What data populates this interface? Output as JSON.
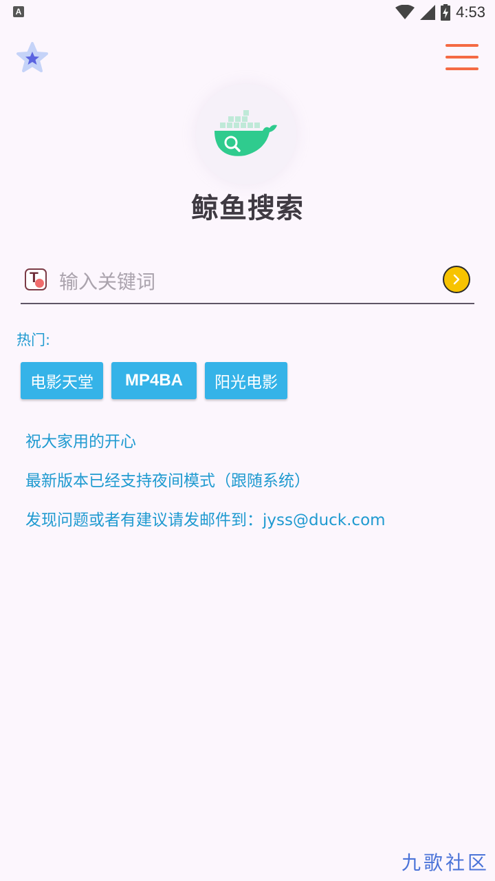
{
  "status_bar": {
    "app_indicator": "A",
    "time": "4:53",
    "icons": [
      "wifi-icon",
      "signal-icon",
      "battery-charging-icon"
    ]
  },
  "top_bar": {
    "favorites_icon": "star-icon",
    "menu_icon": "hamburger-menu-icon"
  },
  "app": {
    "logo_icon": "whale-search-logo",
    "title": "鲸鱼搜索"
  },
  "search": {
    "left_icon": "text-t-icon",
    "placeholder": "输入关键词",
    "value": "",
    "submit_icon": "chevron-right-icon"
  },
  "hot": {
    "label": "热门:",
    "tags": [
      "电影天堂",
      "MP4BA",
      "阳光电影"
    ]
  },
  "notices": [
    "祝大家用的开心",
    "最新版本已经支持夜间模式（跟随系统）",
    "发现问题或者有建议请发邮件到：jyss@duck.com"
  ],
  "watermark": "九歌社区",
  "colors": {
    "background": "#fcf6fd",
    "accent_blue": "#35b3e8",
    "link_blue": "#1f9ad0",
    "menu_orange": "#f46a43",
    "logo_green": "#2fcb8e",
    "search_button_yellow": "#f7c300",
    "title_text": "#3f3a42"
  }
}
